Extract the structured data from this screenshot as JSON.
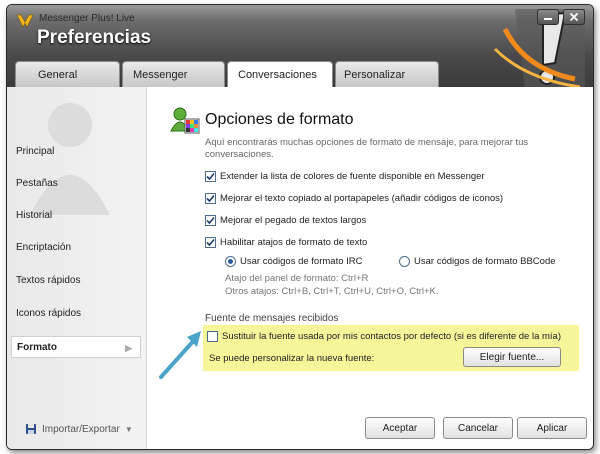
{
  "window": {
    "app_title": "Messenger Plus! Live",
    "page_title": "Preferencias"
  },
  "tabs": [
    {
      "label": "General"
    },
    {
      "label": "Messenger"
    },
    {
      "label": "Conversaciones",
      "active": true
    },
    {
      "label": "Personalizar"
    }
  ],
  "sidebar": {
    "items": [
      {
        "label": "Principal"
      },
      {
        "label": "Pestañas"
      },
      {
        "label": "Historial"
      },
      {
        "label": "Encriptación"
      },
      {
        "label": "Textos rápidos"
      },
      {
        "label": "Iconos rápidos"
      },
      {
        "label": "Formato",
        "active": true
      }
    ],
    "export_label": "Importar/Exportar"
  },
  "section": {
    "title": "Opciones de formato",
    "description": "Aquí encontrarás muchas opciones de formato de mensaje, para mejorar tus conversaciones.",
    "options": [
      {
        "label": "Extender la lista de colores de fuente disponible en Messenger",
        "checked": true
      },
      {
        "label": "Mejorar el texto copiado al portapapeles (añadir códigos de iconos)",
        "checked": true
      },
      {
        "label": "Mejorar el pegado de textos largos",
        "checked": true
      },
      {
        "label": "Habilitar atajos de formato de texto",
        "checked": true
      }
    ],
    "radios": [
      {
        "label": "Usar códigos de formato IRC",
        "selected": true
      },
      {
        "label": "Usar códigos de formato BBCode",
        "selected": false
      }
    ],
    "hint_line1": "Atajo del panel de formato: Ctrl+R",
    "hint_line2": "Otros atajos: Ctrl+B, Ctrl+T, Ctrl+U, Ctrl+O, Ctrl+K."
  },
  "received_fonts": {
    "heading": "Fuente de mensajes recibidos",
    "replace_label": "Sustituir la fuente usada por mis contactos por defecto (si es diferente de la mía)",
    "replace_checked": false,
    "customize_label": "Se puede personalizar la nueva fuente:",
    "choose_button": "Elegir fuente..."
  },
  "footer": {
    "accept": "Aceptar",
    "cancel": "Cancelar",
    "apply": "Aplicar"
  },
  "colors": {
    "highlight": "#f5f59a",
    "arrow": "#4aa3c8",
    "titlebar": "#4a4a4a",
    "brand_orange": "#f08a1c"
  }
}
